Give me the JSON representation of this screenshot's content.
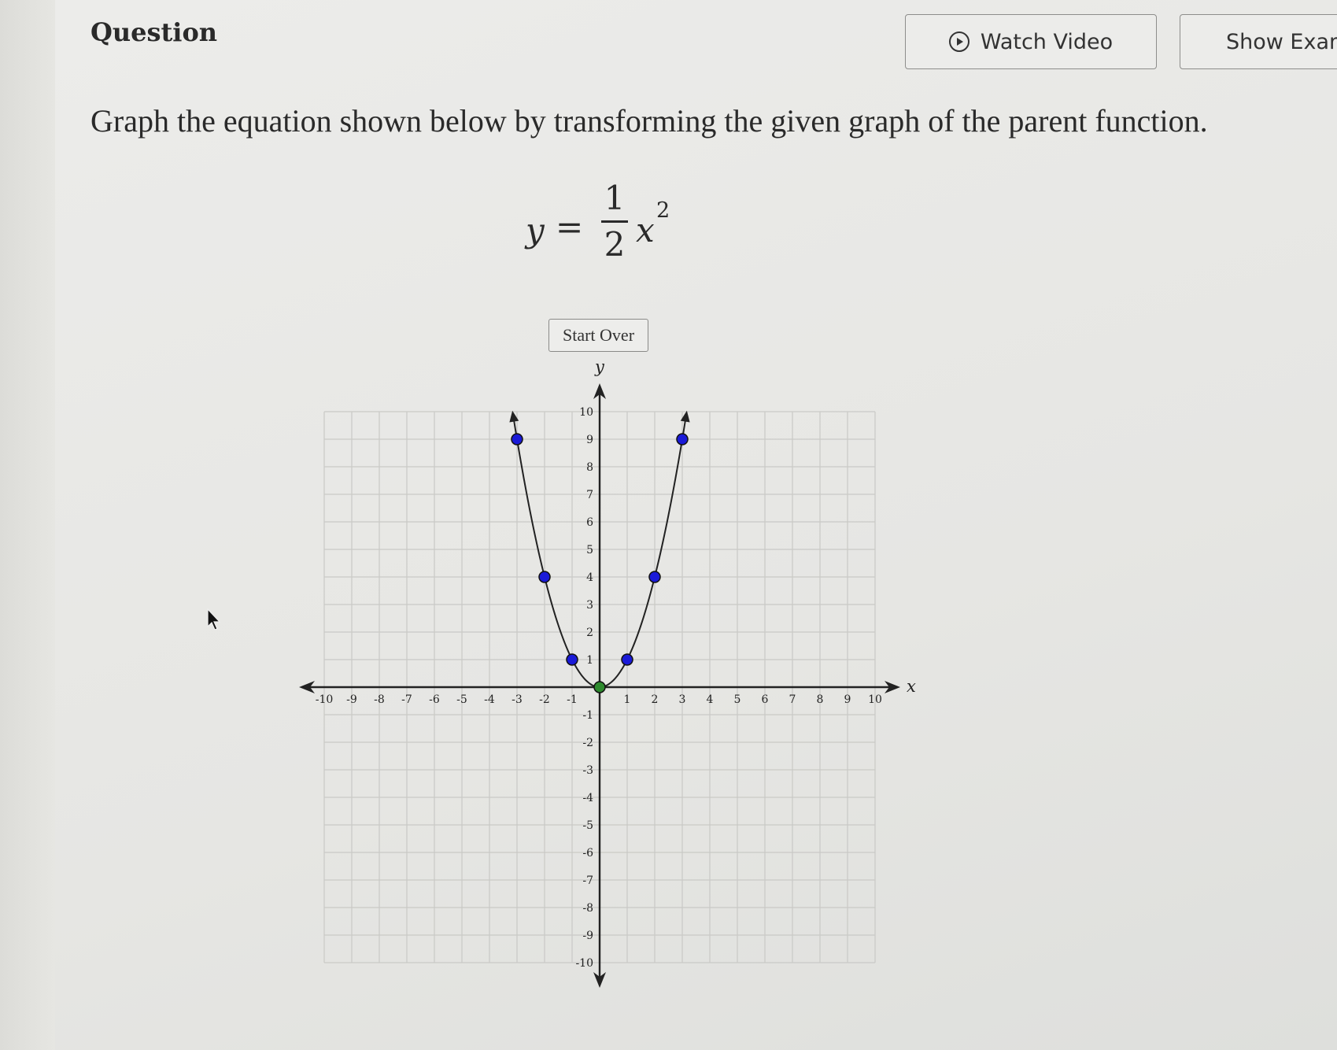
{
  "header": {
    "title": "Question",
    "watch_video_label": "Watch Video",
    "show_example_label": "Show Exam"
  },
  "question": {
    "prompt": "Graph the equation shown below by transforming the given graph of the parent function.",
    "equation": {
      "lhs": "y",
      "equals": "=",
      "numerator": "1",
      "denominator": "2",
      "variable": "x",
      "exponent": "2"
    }
  },
  "controls": {
    "start_over_label": "Start Over"
  },
  "graph": {
    "x_axis_label": "x",
    "y_axis_label": "y",
    "x_range": [
      -10,
      10
    ],
    "y_range": [
      -10,
      10
    ],
    "grid": true,
    "x_tick_labels": [
      "-10",
      "-9",
      "-8",
      "-7",
      "-6",
      "-5",
      "-4",
      "-3",
      "-2",
      "-1",
      "1",
      "2",
      "3",
      "4",
      "5",
      "6",
      "7",
      "8",
      "9",
      "10"
    ],
    "y_tick_labels": [
      "10",
      "9",
      "8",
      "7",
      "6",
      "5",
      "4",
      "3",
      "2",
      "1",
      "-1",
      "-2",
      "-3",
      "-4",
      "-5",
      "-6",
      "-7",
      "-8",
      "-9",
      "-10"
    ],
    "curve": {
      "function": "y = x^2",
      "color": "#222222",
      "points": [
        {
          "x": -3,
          "y": 9,
          "color": "#1a1ad8"
        },
        {
          "x": -2,
          "y": 4,
          "color": "#1a1ad8"
        },
        {
          "x": -1,
          "y": 1,
          "color": "#1a1ad8"
        },
        {
          "x": 0,
          "y": 0,
          "color": "#2e8a2e"
        },
        {
          "x": 1,
          "y": 1,
          "color": "#1a1ad8"
        },
        {
          "x": 2,
          "y": 4,
          "color": "#1a1ad8"
        },
        {
          "x": 3,
          "y": 9,
          "color": "#1a1ad8"
        }
      ]
    }
  },
  "colors": {
    "point_blue": "#1a1ad8",
    "vertex_green": "#2e8a2e",
    "grid_line": "#c9c9c6",
    "axis": "#222222"
  }
}
